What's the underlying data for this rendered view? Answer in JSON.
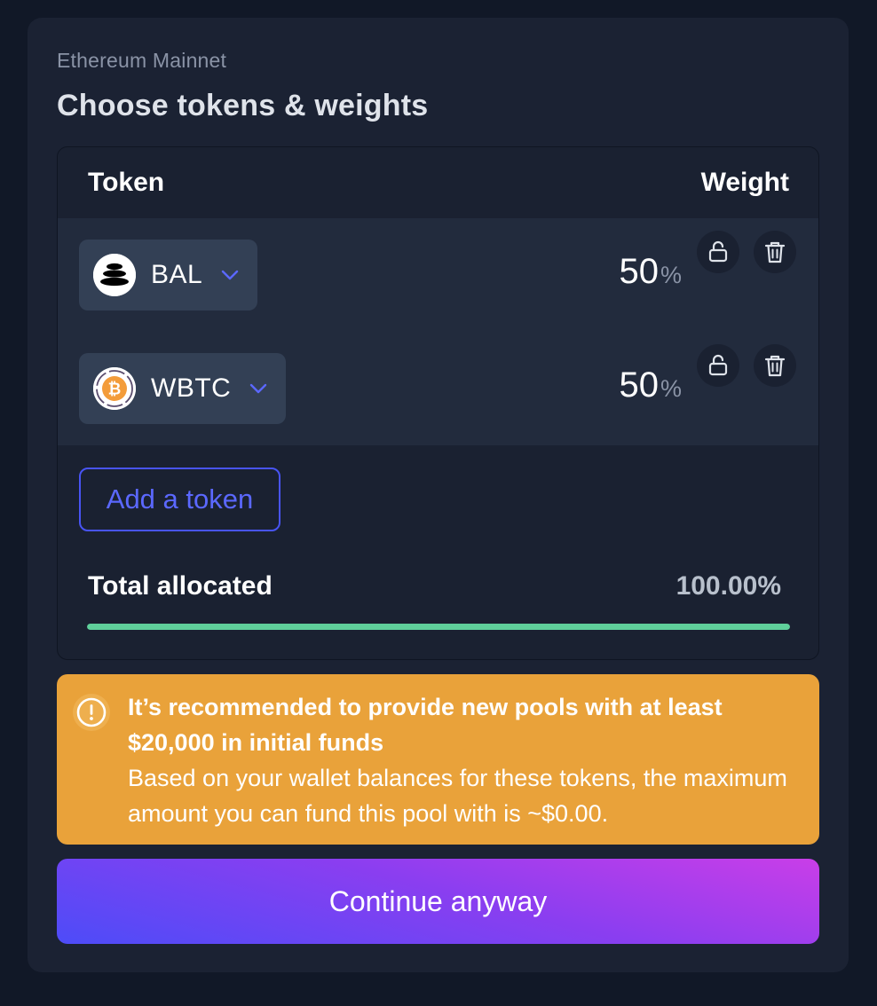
{
  "header": {
    "network": "Ethereum Mainnet",
    "title": "Choose tokens & weights"
  },
  "table": {
    "col_token": "Token",
    "col_weight": "Weight",
    "rows": [
      {
        "symbol": "BAL",
        "weight": "50",
        "unit": "%",
        "logo": "balancer-logo",
        "lock_icon": "unlock-icon",
        "delete_icon": "trash-icon"
      },
      {
        "symbol": "WBTC",
        "weight": "50",
        "unit": "%",
        "logo": "wbtc-logo",
        "lock_icon": "unlock-icon",
        "delete_icon": "trash-icon"
      }
    ],
    "add_token_label": "Add a token",
    "total_label": "Total allocated",
    "total_value": "100.00%",
    "progress_fraction": 1.0
  },
  "alert": {
    "icon": "warning-icon",
    "title": "It’s recommended to provide new pools with at least $20,000 in initial funds",
    "body": "Based on your wallet balances for these tokens, the maximum amount you can fund this pool with is ~$0.00."
  },
  "actions": {
    "continue_label": "Continue anyway"
  },
  "colors": {
    "page_bg": "#111827",
    "card_bg": "#1b2233",
    "accent": "#4854f4",
    "progress": "#5fd09b",
    "alert_bg": "#e9a23a"
  }
}
